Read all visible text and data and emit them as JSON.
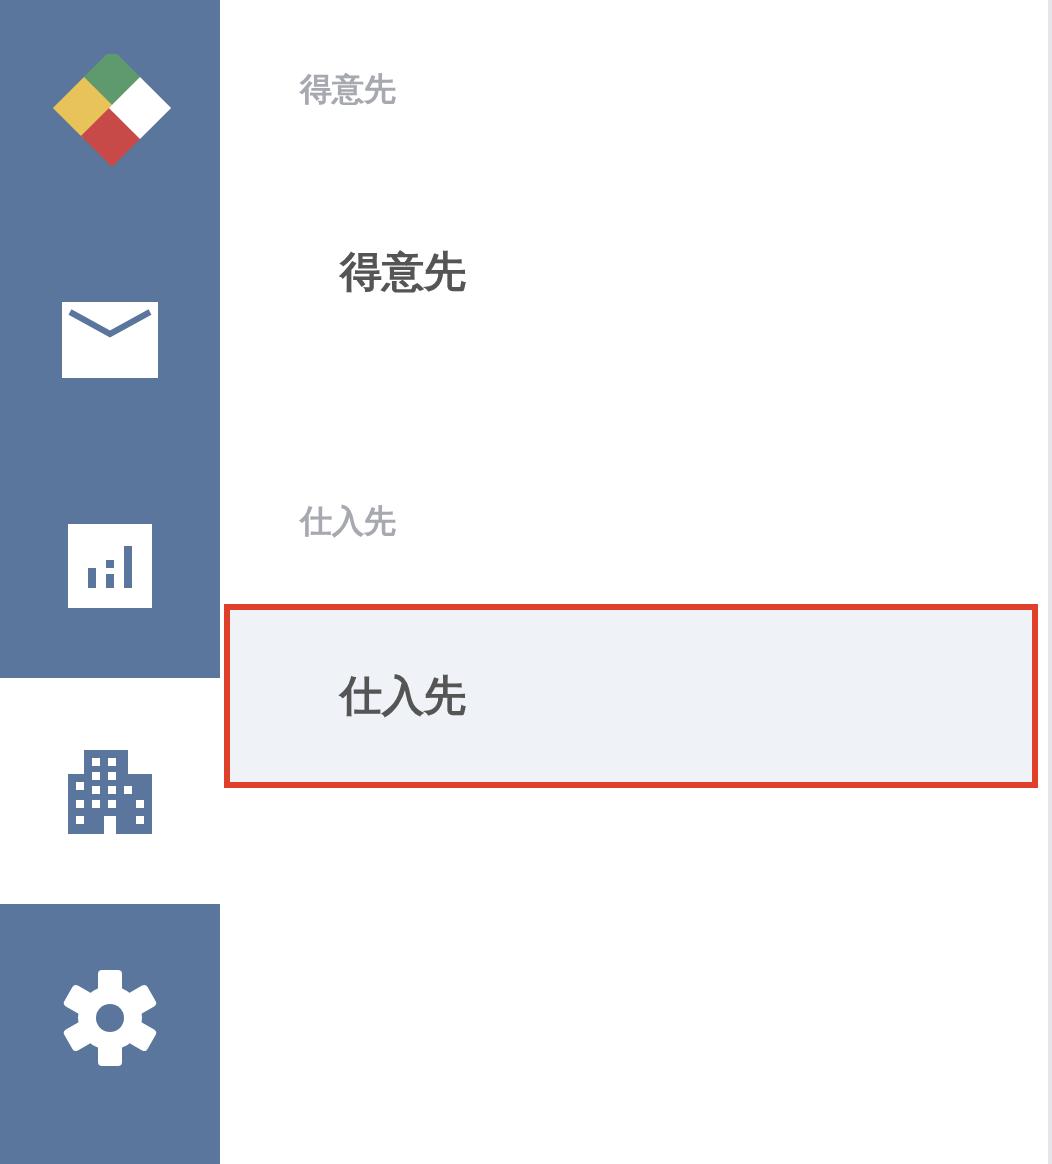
{
  "rail": [
    {
      "kind": "logo",
      "selected": false
    },
    {
      "kind": "mail",
      "selected": false
    },
    {
      "kind": "chart",
      "selected": false
    },
    {
      "kind": "building",
      "selected": true
    },
    {
      "kind": "settings",
      "selected": false
    }
  ],
  "sections": [
    {
      "header": "得意先",
      "items": [
        {
          "label": "得意先",
          "selected": false
        }
      ]
    },
    {
      "header": "仕入先",
      "items": [
        {
          "label": "仕入先",
          "selected": true
        }
      ]
    }
  ]
}
